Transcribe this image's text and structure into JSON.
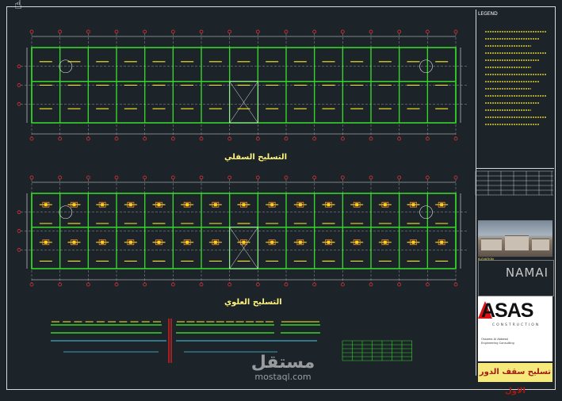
{
  "drawing": {
    "upper_plan_title": "التسليح السفلي",
    "lower_plan_title": "التسليح العلوي",
    "legend_header": "LEGEND",
    "photo_caption": "ELEVATION",
    "namai_logo": "NAMAI",
    "asas_logo": "ASAS",
    "asas_subtitle": "CONSTRUCTION",
    "company_name_en": "Ossama Al Abbassi",
    "company_line2": "Engineering Consulting",
    "sheet_title": "تسليح سقف الدور الاول"
  },
  "watermark": {
    "arabic": "مستقل",
    "english": "mostaql.com"
  },
  "colors": {
    "background": "#1c2329",
    "beam": "#35d629",
    "rebar": "#ffee22",
    "grid": "#e8e8e8",
    "axis": "#ff3333"
  },
  "icons": {
    "cursor": "hand-cursor-icon"
  }
}
